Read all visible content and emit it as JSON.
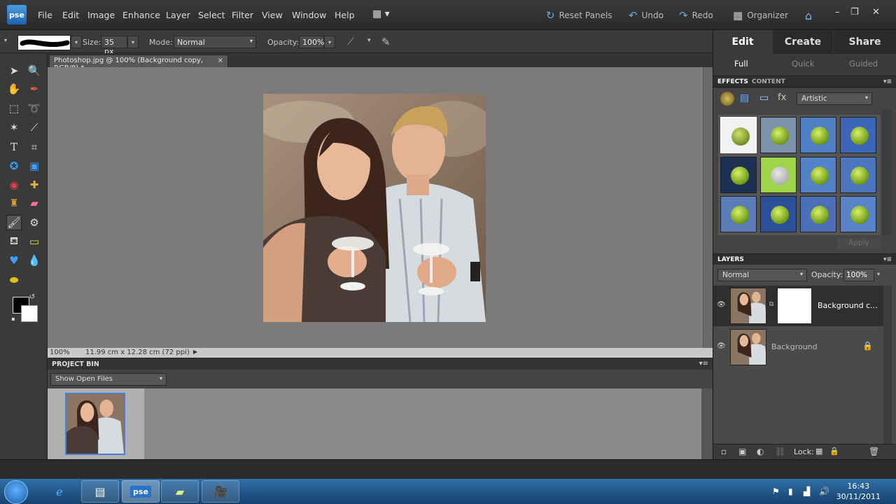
{
  "app": {
    "logo": "pse"
  },
  "menu": [
    "File",
    "Edit",
    "Image",
    "Enhance",
    "Layer",
    "Select",
    "Filter",
    "View",
    "Window",
    "Help"
  ],
  "top_actions": {
    "reset_panels": "Reset Panels",
    "undo": "Undo",
    "redo": "Redo",
    "organizer": "Organizer"
  },
  "options": {
    "size_label": "Size:",
    "size_value": "35 px",
    "mode_label": "Mode:",
    "mode_value": "Normal",
    "opacity_label": "Opacity:",
    "opacity_value": "100%"
  },
  "document": {
    "tab_title": "Photoshop.jpg @ 100% (Background copy, RGB/8) *",
    "close": "×",
    "zoom": "100%",
    "doc_info": "11.99 cm x 12.28 cm (72 ppi)"
  },
  "project_bin": {
    "title": "PROJECT BIN",
    "filter": "Show Open Files"
  },
  "panel_tabs": {
    "edit": "Edit",
    "create": "Create",
    "share": "Share"
  },
  "edit_modes": {
    "full": "Full",
    "quick": "Quick",
    "guided": "Guided"
  },
  "effects": {
    "tab_effects": "EFFECTS",
    "tab_content": "CONTENT",
    "category": "Artistic",
    "apply": "Apply"
  },
  "layers": {
    "title": "LAYERS",
    "blend_mode": "Normal",
    "opacity_label": "Opacity:",
    "opacity_value": "100%",
    "items": [
      {
        "name": "Background c..."
      },
      {
        "name": "Background"
      }
    ],
    "lock_label": "Lock:"
  },
  "taskbar": {
    "pse_label": "pse",
    "time": "16:43",
    "date": "30/11/2011"
  },
  "colors": {
    "accent": "#4a7fcf",
    "panel_bg": "#3a3a3a",
    "canvas_bg": "#7b7b7b"
  }
}
